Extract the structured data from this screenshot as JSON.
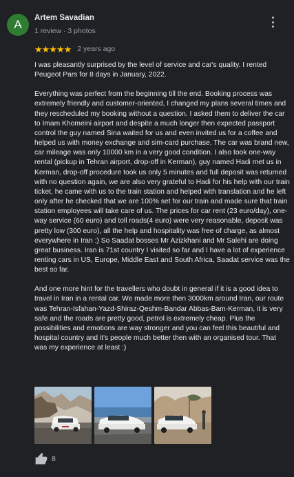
{
  "author": {
    "name": "Artem Savadian",
    "initial": "A",
    "meta": "1 review · 3 photos",
    "avatar_color": "#2e7d32"
  },
  "rating": {
    "stars": "★★★★★",
    "value": 5,
    "max": 5,
    "date": "2 years ago",
    "star_color": "#fbbc04"
  },
  "review": {
    "paragraphs": [
      "I was pleasantly surprised by the level of service and car's quality. I rented Peugeot Pars for 8 days in January, 2022.",
      "Everything was perfect from the beginning till the end. Booking process was extremely friendly and customer-oriented, I changed my plans several times and they rescheduled my booking without a question. I asked them to deliver the car to Imam Khomeini airport and despite a much longer then expected passport control the guy named Sina waited for us and even invited us for a coffee and helped us with money exchange and sim-card purchase. The car was brand new, car mileage was only 10000 km in a very good condition. I also took one-way rental (pickup in Tehran airport, drop-off in Kerman), guy named Hadi met us in Kerman, drop-off procedure took us only 5 minutes and full deposit was returned with no question again, we are also very grateful to Hadi for his help with our train ticket, he came with us to the train station and helped with translation and he left only after he checked that we are 100% set for our train and made sure that train station employees will take care of us. The prices for car rent (23 euro/day), one-way service (60 euro) and toll roads(4 euro) were very reasonable, deposit was pretty low (300 euro), all the help and hospitality was free of charge, as almost everywhere in Iran :) So Saadat bosses Mr Azizkhani and Mr Salehi  are doing great business. Iran is 71st country I visited so far and I have a lot of experience renting cars in US, Europe, Middle East and South Africa, Saadat service was the best so far.",
      "And one more hint for the travellers who doubt in general if it is a good idea to travel in Iran in a rental car. We made more then 3000km around Iran, our route was Tehran-Isfahan-Yazd-Shiraz-Qeshm-Bandar Abbas-Bam-Kerman, it is very safe and the roads are pretty good, petrol is extremely cheap. Plus the possibilities and emotions are way stronger and you can feel this beautiful and hospital country and it's people much better then with an organised tour. That was my experience at least :)"
    ]
  },
  "photos": [
    {
      "name": "photo-car-canyon"
    },
    {
      "name": "photo-car-seaside"
    },
    {
      "name": "photo-car-desert"
    }
  ],
  "actions": {
    "like_icon": "thumbs-up-icon",
    "like_count": "8"
  },
  "more_icon": "more-vert-icon"
}
